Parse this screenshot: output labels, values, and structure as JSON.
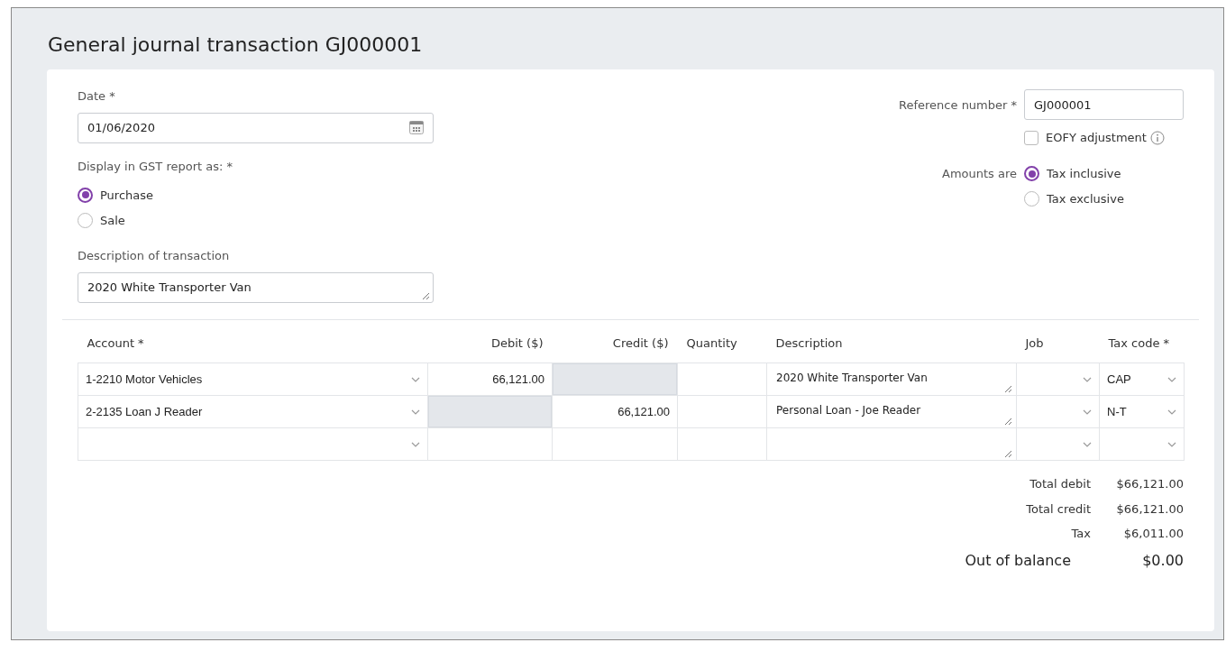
{
  "title": "General journal transaction GJ000001",
  "date": {
    "label": "Date *",
    "value": "01/06/2020"
  },
  "gst": {
    "label": "Display in GST report as: *",
    "options": [
      {
        "label": "Purchase",
        "selected": true
      },
      {
        "label": "Sale",
        "selected": false
      }
    ]
  },
  "description": {
    "label": "Description of transaction",
    "value": "2020 White Transporter Van"
  },
  "reference": {
    "label": "Reference number *",
    "value": "GJ000001"
  },
  "eofy": {
    "label": "EOFY adjustment",
    "checked": false
  },
  "amounts": {
    "label": "Amounts are",
    "options": [
      {
        "label": "Tax inclusive",
        "selected": true
      },
      {
        "label": "Tax exclusive",
        "selected": false
      }
    ]
  },
  "table": {
    "columns": [
      "Account *",
      "Debit ($)",
      "Credit ($)",
      "Quantity",
      "Description",
      "Job",
      "Tax code *"
    ],
    "rows": [
      {
        "account": "1-2210 Motor Vehicles",
        "debit": "66,121.00",
        "debit_disabled": false,
        "credit_disabled": true,
        "description": "2020 White Transporter Van",
        "tax_code": "CAP"
      },
      {
        "account": "2-2135 Loan J Reader",
        "credit": "66,121.00",
        "debit_disabled": true,
        "credit_disabled": false,
        "description": "Personal Loan - Joe Reader",
        "tax_code": "N-T"
      },
      {
        "debit_disabled": false,
        "credit_disabled": false
      }
    ]
  },
  "totals": [
    {
      "label": "Total debit",
      "value": "$66,121.00",
      "kind": "normal"
    },
    {
      "label": "Total credit",
      "value": "$66,121.00",
      "kind": "normal"
    },
    {
      "label": "Tax",
      "value": "$6,011.00",
      "kind": "normal"
    },
    {
      "label": "Out of balance",
      "value": "$0.00",
      "kind": "grand"
    }
  ]
}
